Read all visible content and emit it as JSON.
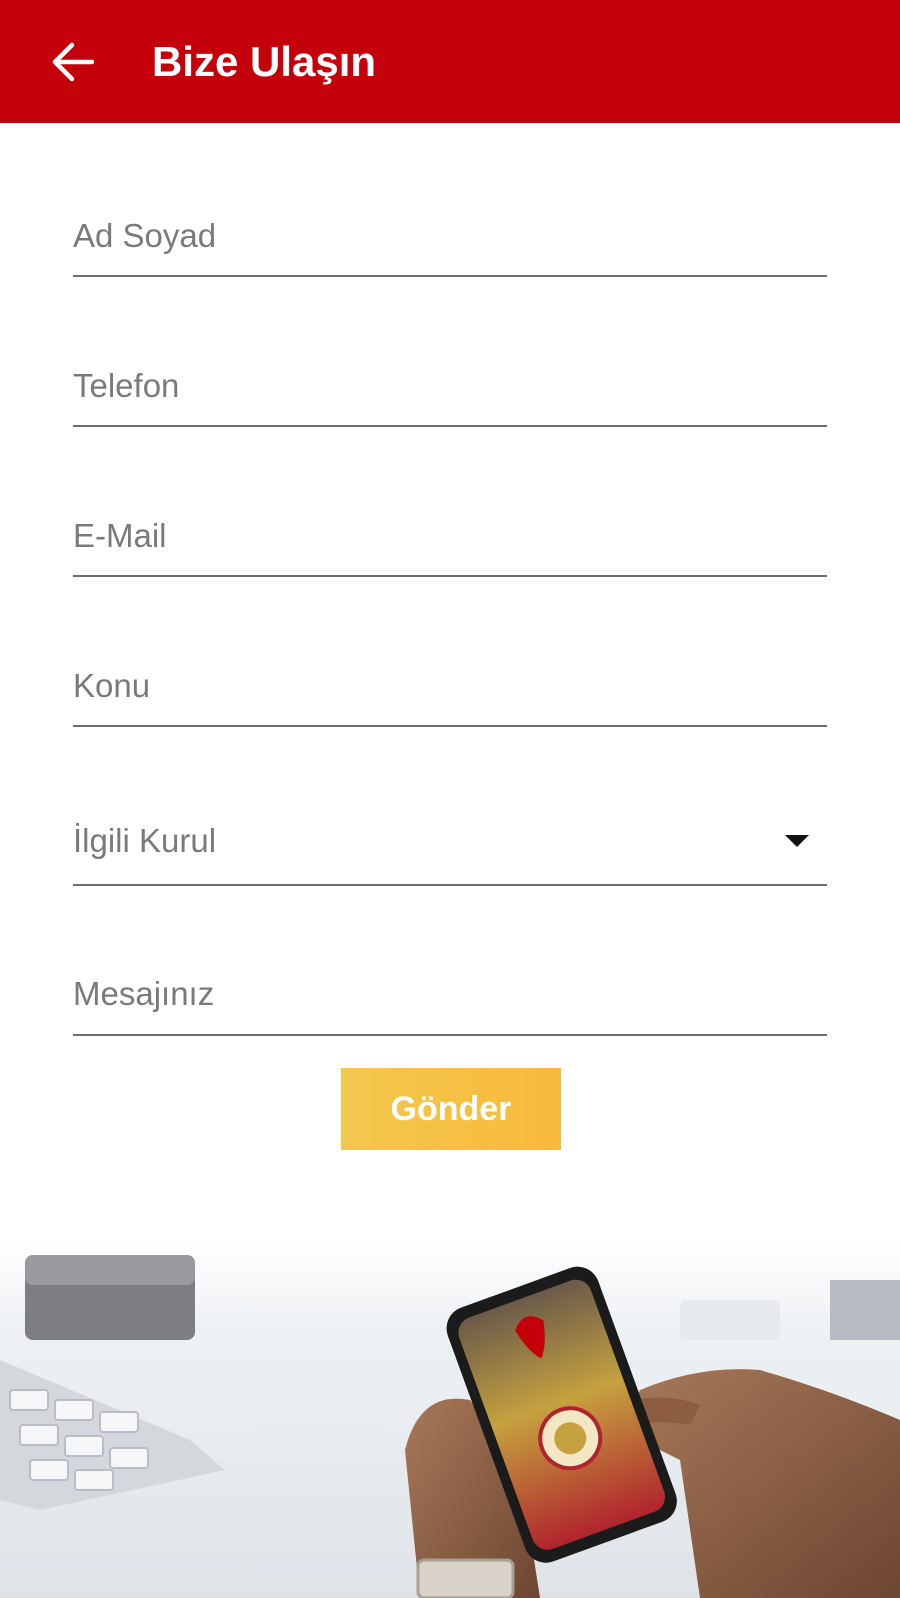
{
  "header": {
    "title": "Bize Ulaşın",
    "back_icon": "arrow-left-icon",
    "background": "#c4000b"
  },
  "form": {
    "ad_soyad": {
      "placeholder": "Ad Soyad",
      "value": ""
    },
    "telefon": {
      "placeholder": "Telefon",
      "value": ""
    },
    "email": {
      "placeholder": "E-Mail",
      "value": ""
    },
    "konu": {
      "placeholder": "Konu",
      "value": ""
    },
    "ilgili_kurul": {
      "selected": "İlgili Kurul",
      "icon": "caret-down-icon"
    },
    "mesaj": {
      "placeholder": "Mesajınız",
      "value": ""
    },
    "submit_label": "Gönder",
    "submit_color": "#f6c143"
  },
  "banner": {
    "description_icon": "phone-in-hands-photo"
  }
}
